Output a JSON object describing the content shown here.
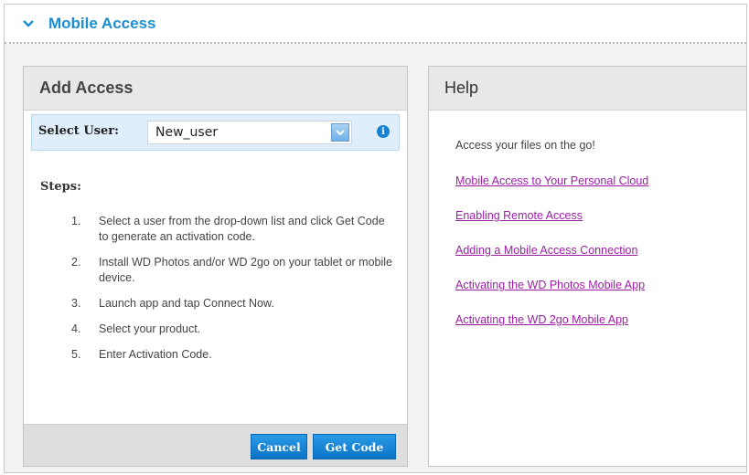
{
  "section": {
    "title": "Mobile Access"
  },
  "add_access": {
    "title": "Add Access",
    "select_label": "Select User:",
    "selected_user": "New_user",
    "steps_label": "Steps:",
    "steps": [
      {
        "num": "1.",
        "text": "Select a user from the drop-down list and click Get Code to generate an activation code."
      },
      {
        "num": "2.",
        "text": "Install WD Photos and/or WD 2go on your tablet or mobile device."
      },
      {
        "num": "3.",
        "text": "Launch app and tap Connect Now."
      },
      {
        "num": "4.",
        "text": "Select your product."
      },
      {
        "num": "5.",
        "text": "Enter Activation Code."
      }
    ],
    "cancel_label": "Cancel",
    "get_code_label": "Get Code"
  },
  "help": {
    "title": "Help",
    "intro": "Access your files on the go!",
    "links": [
      "Mobile Access to Your Personal Cloud",
      "Enabling Remote Access",
      "Adding a Mobile Access Connection",
      "Activating the WD Photos Mobile App",
      "Activating the WD 2go Mobile App"
    ]
  },
  "icons": {
    "section_toggle": "chevron-down-icon",
    "dropdown": "dropdown-arrow-icon",
    "info": "info-icon"
  },
  "colors": {
    "accent": "#1b8fd1",
    "button": "#0b73c6",
    "link": "#9c1ea6",
    "select_row_bg": "#dfeefa"
  }
}
